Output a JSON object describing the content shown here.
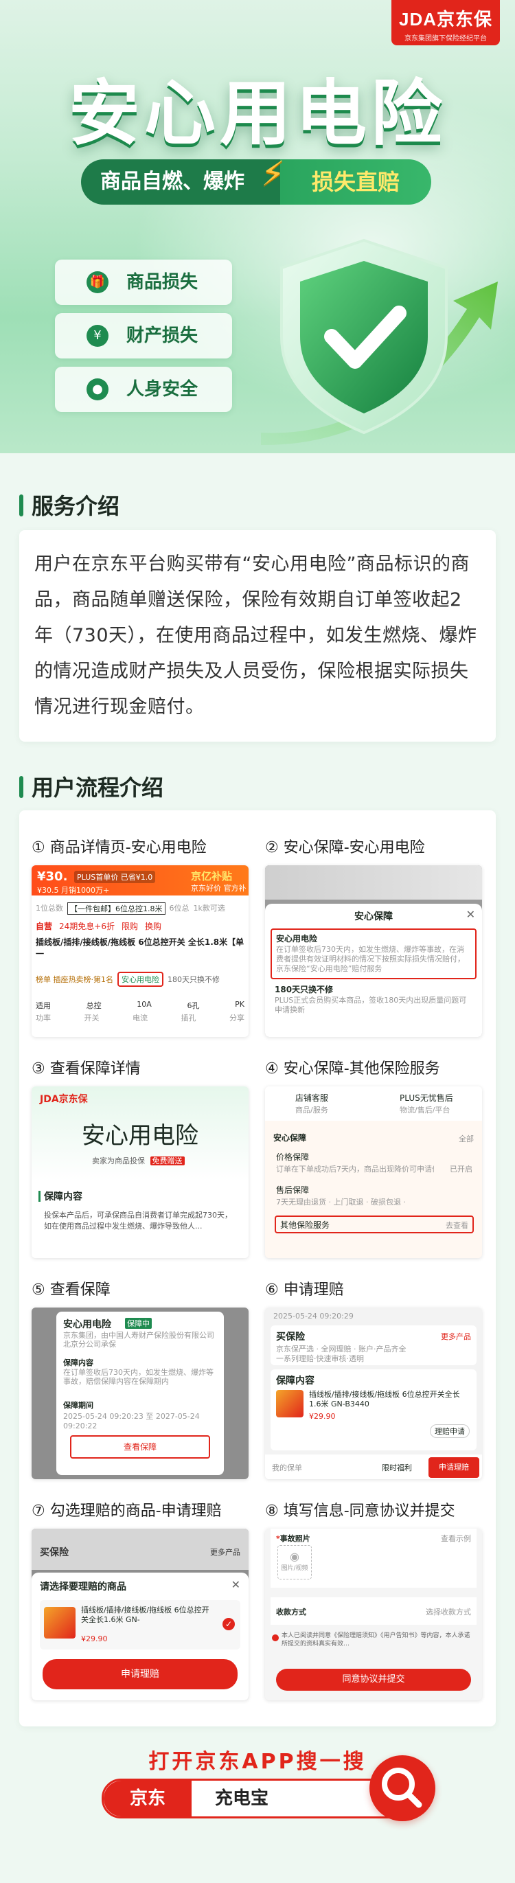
{
  "logo": {
    "brand": "JDA京东保",
    "tagline": "京东集团旗下保险经纪平台"
  },
  "hero": {
    "title": "安心用电险",
    "sub_left": "商品自燃、爆炸",
    "sub_right": "损失直赔",
    "chips": [
      "商品损失",
      "财产损失",
      "人身安全"
    ]
  },
  "intro": {
    "heading": "服务介绍",
    "body": "用户在京东平台购买带有“安心用电险”商品标识的商品，商品随单赠送保险，保险有效期自订单签收起2年（730天），在使用商品过程中，如发生燃烧、爆炸的情况造成财产损失及人员受伤，保险根据实际损失情况进行现金赔付。"
  },
  "flow": {
    "heading": "用户流程介绍",
    "steps": [
      {
        "title": "① 商品详情页-安心用电险"
      },
      {
        "title": "② 安心保障-安心用电险"
      },
      {
        "title": "③ 查看保障详情"
      },
      {
        "title": "④ 安心保障-其他保险服务"
      },
      {
        "title": "⑤ 查看保障"
      },
      {
        "title": "⑥ 申请理赔"
      },
      {
        "title": "⑦ 勾选理赔的商品-申请理赔"
      },
      {
        "title": "⑧ 填写信息-同意协议并提交"
      }
    ]
  },
  "s1": {
    "price": "¥30.",
    "price_tag": "PLUS首单价 已省¥1.0",
    "orig": "¥30.5 月销1000万+",
    "banner": "京亿补贴",
    "banner_sub": "京东好价 官方补",
    "stats": [
      "1位总数",
      "【一件包邮】6位总控1.8米",
      "6位总",
      "1k款可选"
    ],
    "tags": [
      "自营",
      "24期免息+6折",
      "限购",
      "换购"
    ],
    "name": "插线板/插排/接线板/拖线板 6位总控开关 全长1.8米【单一",
    "ins_l": "榜单 插座热卖榜·第1名",
    "ins_mid": "安心用电险",
    "ins_r": "180天只换不修",
    "specs": [
      "适用",
      "总控",
      "10A",
      "6孔",
      "PK"
    ],
    "specs2": [
      "功率",
      "开关",
      "电流",
      "插孔",
      "分享"
    ]
  },
  "s2": {
    "sheet_title": "安心保障",
    "item1_title": "安心用电险",
    "item1_desc": "在订单签收后730天内，如发生燃烧、爆炸等事故，在消费者提供有效证明材料的情况下按照实际损失情况赔付，京东保险“安心用电险”赔付服务",
    "item2_title": "180天只换不修",
    "item2_desc": "PLUS正式会员购买本商品，签收180天内出现质量问题可申请换新"
  },
  "s3": {
    "brand": "JDA京东保",
    "stamp": "安心用电险",
    "seller": "卖家为商品投保",
    "seller_tag": "免费赠送",
    "section": "保障内容",
    "desc": "投保本产品后，可承保商品自消费者订单完成起730天，如在使用商品过程中发生燃烧、爆炸导致他人..."
  },
  "s4": {
    "top1": "店铺客服",
    "top1s": "商品/服务",
    "top2": "PLUS无忧售后",
    "top2s": "物流/售后/平台",
    "heading": "安心保障",
    "more": "全部",
    "row1": "价格保障",
    "row1d": "订单在下单成功后7天内，商品出现降价可申请价保…",
    "row1r": "已开启",
    "row2": "售后保障",
    "row2d": "7天无理由退货 · 上门取退 · 破损包退 ·",
    "row3": "其他保险服务",
    "row3r": "去查看"
  },
  "s5": {
    "title": "安心用电险",
    "title_tag": "保障中",
    "sub": "京东集团，由中国人寿财产保险股份有限公司北京分公司承保",
    "label1": "保障内容",
    "desc1": "在订单签收后730天内，如发生燃烧、爆炸等事故，赔偿保障内容在保障期内",
    "label2": "保障期间",
    "period": "2025-05-24 09:20:23 至 2027-05-24 09:20:22",
    "button": "查看保障"
  },
  "s6": {
    "time": "2025-05-24 09:20:29",
    "tab": "买保险",
    "tab_more": "更多产品",
    "tab_sub": "京东保严选 · 全网理赔 · 账户·产品齐全",
    "tab_desc": "一系列理赔·快速审核·透明",
    "section": "保障内容",
    "product": "插线板/插排/接线板/拖线板 6位总控开关全长1.6米 GN-B3440",
    "price": "¥29.90",
    "claim_link": "理赔申请",
    "btn_left": "限时福利",
    "btn_right": "申请理赔",
    "side": "我的保单"
  },
  "s7": {
    "bg_tab": "买保险",
    "bg_more": "更多产品",
    "sheet_title": "请选择要理赔的商品",
    "product": "插线板/插排/接线板/拖线板 6位总控开关全长1.6米 GN-",
    "price": "¥29.90",
    "button": "申请理赔"
  },
  "s8": {
    "photo": "事故照片",
    "photo_r": "查看示例",
    "upload": "图片/视频",
    "pay_label": "收款方式",
    "pay_value": "选择收款方式",
    "agree": "本人已阅读并同意《保险理赔须知》《用户告知书》等内容，本人承诺所提交的资料真实有效…",
    "submit": "同意协议并提交"
  },
  "bottom": {
    "title": "打开京东APP搜一搜",
    "brand": "京东",
    "keyword": "充电宝"
  }
}
